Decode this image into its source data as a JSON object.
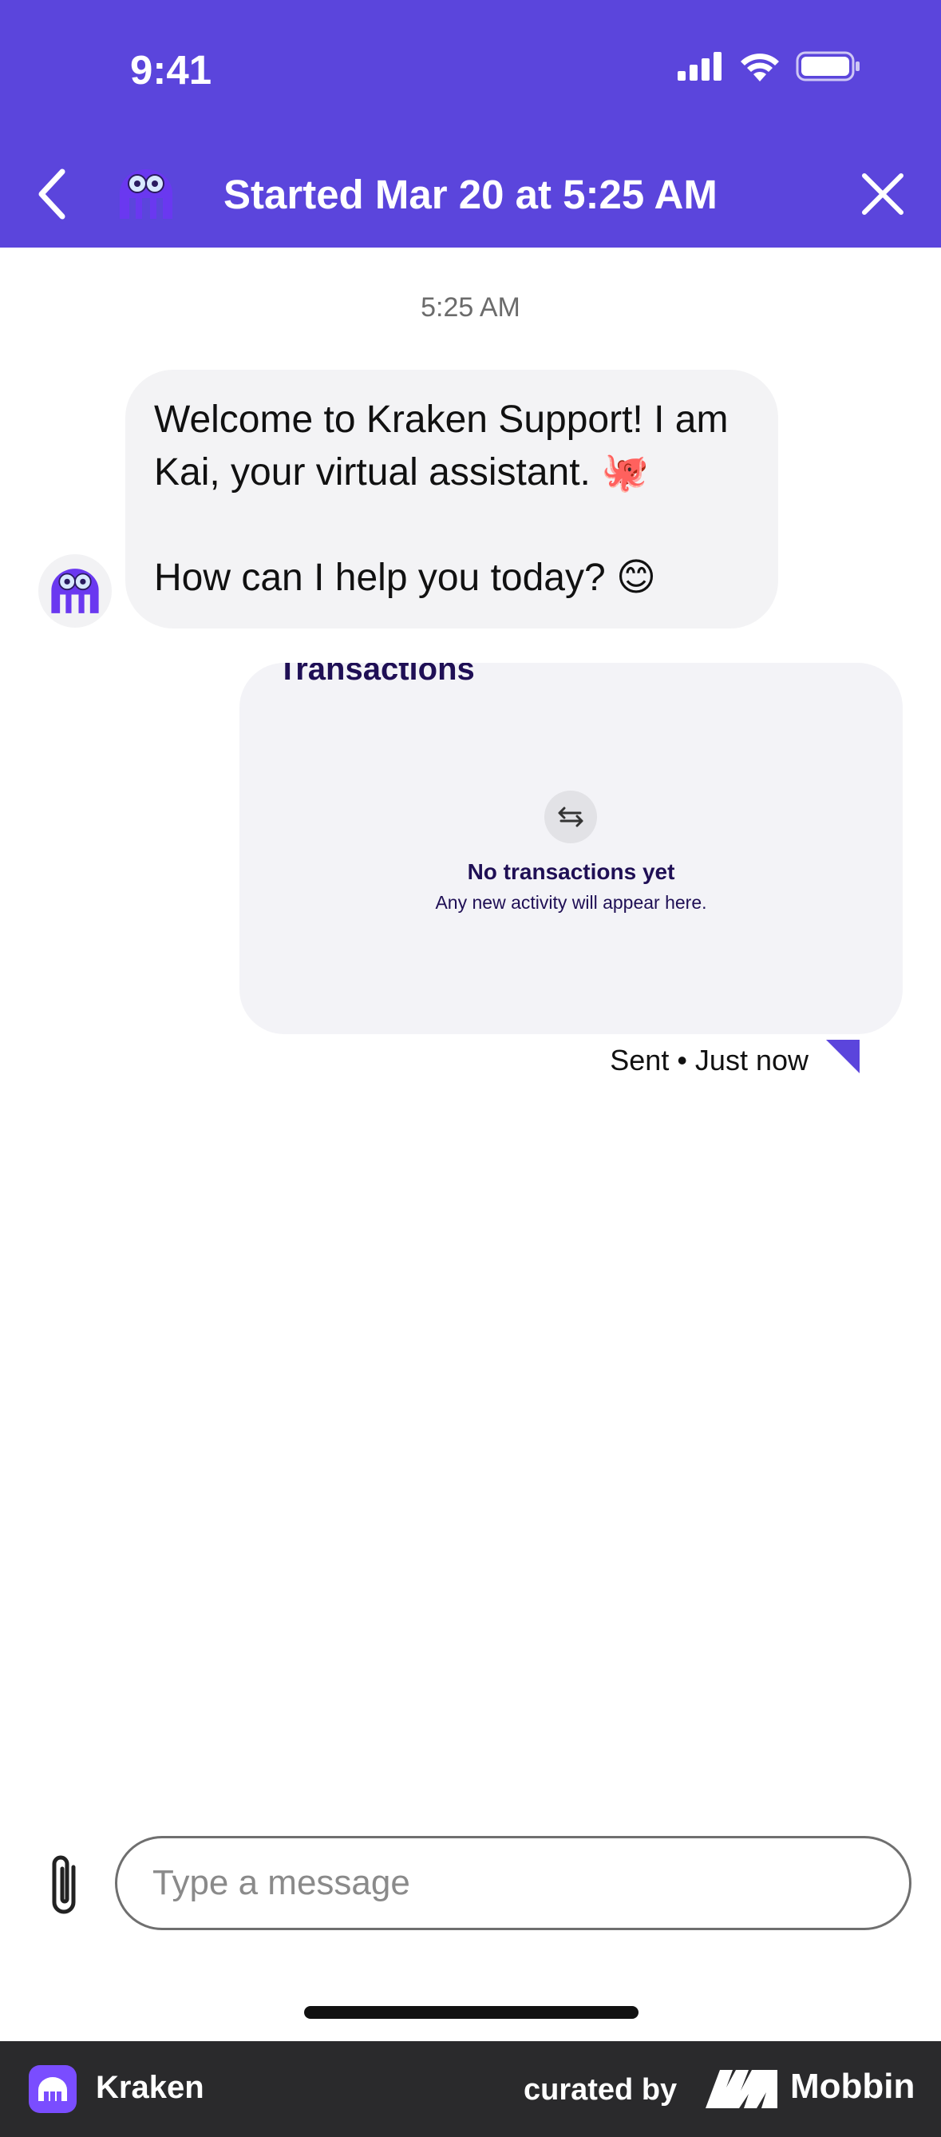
{
  "status_bar": {
    "time": "9:41"
  },
  "nav": {
    "title": "Started Mar 20 at 5:25 AM",
    "back_icon": "chevron-left-icon",
    "close_icon": "close-icon"
  },
  "conversation": {
    "timestamp": "5:25 AM",
    "bot_message": {
      "line1": "Welcome to Kraken Support! I am Kai, your virtual assistant. 🐙",
      "line2": "How can I help you today? 😊"
    },
    "card": {
      "title": "Transactions",
      "empty_heading": "No transactions yet",
      "empty_sub": "Any new activity will appear here."
    },
    "sent_status": "Sent • Just now"
  },
  "composer": {
    "placeholder": "Type a message"
  },
  "footer": {
    "app_name": "Kraken",
    "curated_by": "curated by",
    "brand": "Mobbin"
  },
  "colors": {
    "accent": "#5b45dc",
    "bubble": "#f3f3f5",
    "card_text": "#1f0f55"
  }
}
